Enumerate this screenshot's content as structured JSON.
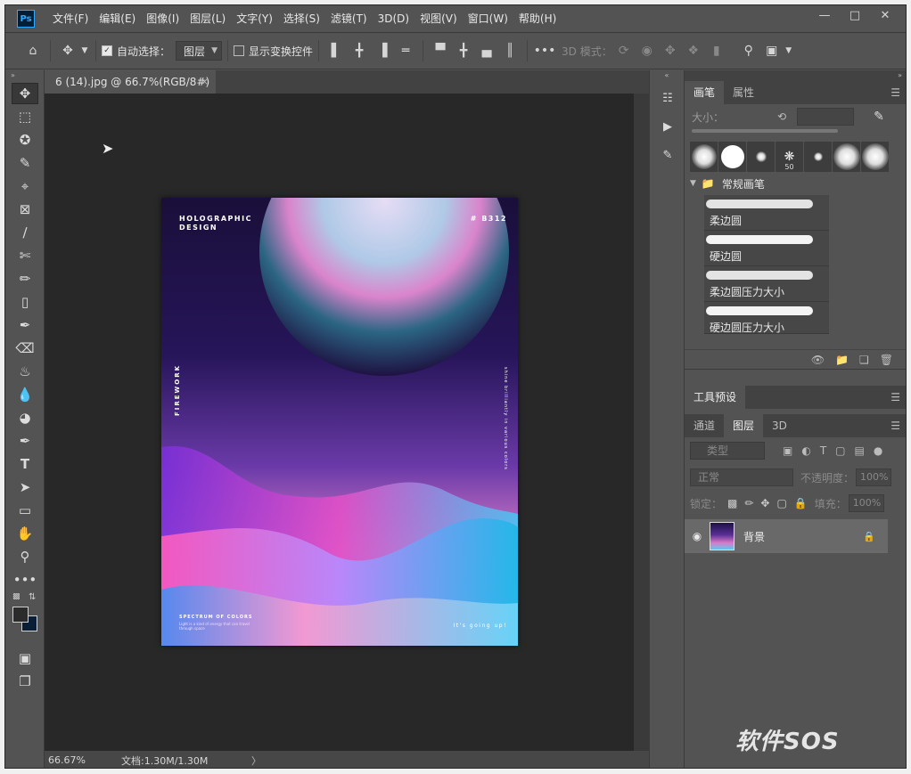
{
  "menu": [
    "文件(F)",
    "编辑(E)",
    "图像(I)",
    "图层(L)",
    "文字(Y)",
    "选择(S)",
    "滤镜(T)",
    "3D(D)",
    "视图(V)",
    "窗口(W)",
    "帮助(H)"
  ],
  "app_logo": "Ps",
  "options": {
    "auto_select_label": "自动选择：",
    "auto_select_value": "图层",
    "show_transform_label": "显示变换控件",
    "mode_3d_label": "3D 模式："
  },
  "document": {
    "tab_title": "6 (14).jpg @ 66.7%(RGB/8#)",
    "close": "×"
  },
  "status": {
    "zoom": "66.67%",
    "doc_info": "文档:1.30M/1.30M",
    "arrow": "〉"
  },
  "poster": {
    "title": "HOLOGRAPHIC DESIGN",
    "code": "# B312",
    "side_text": "FIREWORK",
    "side_text_right": "shine brilliantly in various colors",
    "spectrum": "SPECTRUM OF COLORS",
    "small_text": "Light is a kind of energy that can travel through space",
    "going": "It's going up!"
  },
  "brush_panel": {
    "tabs": [
      "画笔",
      "属性"
    ],
    "size_label": "大小：",
    "brush_label": "50",
    "group_name": "常规画笔",
    "brushes": [
      "柔边圆",
      "硬边圆",
      "柔边圆压力大小",
      "硬边圆压力大小"
    ]
  },
  "tool_presets": {
    "tab": "工具预设"
  },
  "layers_panel": {
    "tabs": [
      "通道",
      "图层",
      "3D"
    ],
    "search_placeholder": "类型",
    "blend_mode": "正常",
    "opacity_label": "不透明度：",
    "opacity_value": "100%",
    "lock_label": "锁定：",
    "fill_label": "填充：",
    "fill_value": "100%",
    "layer_name": "背景"
  },
  "watermark": "软件SOS"
}
